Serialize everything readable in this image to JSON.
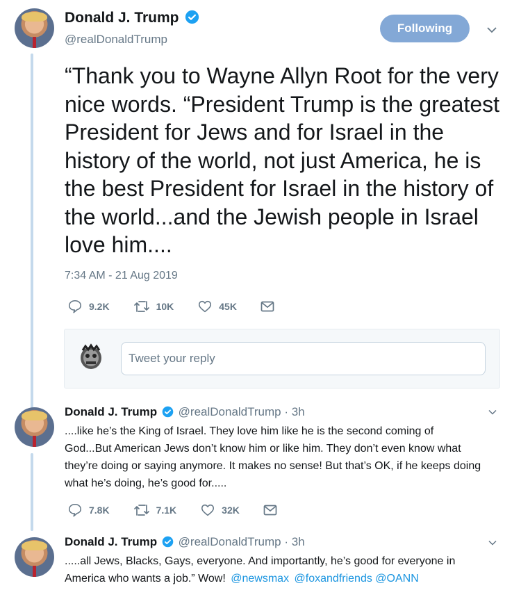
{
  "main_tweet": {
    "name": "Donald J. Trump",
    "handle": "@realDonaldTrump",
    "follow_label": "Following",
    "text": "“Thank you to Wayne Allyn Root for the very nice words. “President Trump is the greatest President for Jews and for Israel in the history of the world, not just America, he is the best President for Israel in the history of the world...and the Jewish people in Israel love him....",
    "timestamp": "7:34 AM - 21 Aug 2019",
    "replies": "9.2K",
    "retweets": "10K",
    "likes": "45K"
  },
  "reply_box": {
    "placeholder": "Tweet your reply"
  },
  "thread": [
    {
      "name": "Donald J. Trump",
      "handle": "@realDonaldTrump",
      "time": "· 3h",
      "text": "....like he’s the King of Israel. They love him like he is the second coming of God...But American Jews don’t know him or like him. They don’t even know what they’re doing or saying anymore. It makes no sense! But that’s OK, if he keeps doing what he’s doing, he’s good for.....",
      "replies": "7.8K",
      "retweets": "7.1K",
      "likes": "32K"
    },
    {
      "name": "Donald J. Trump",
      "handle": "@realDonaldTrump",
      "time": "· 3h",
      "text_before": ".....all Jews, Blacks, Gays, everyone. And importantly, he’s good for everyone in America who wants a job.” Wow!",
      "mentions": [
        "@newsmax",
        "@foxandfriends",
        "@OANN"
      ]
    }
  ],
  "colors": {
    "accent": "#1da1f2",
    "follow_button": "#83a8d6",
    "secondary_text": "#657786",
    "thread_line": "#c4d9ec"
  },
  "icons": [
    "verified-badge-icon",
    "chevron-down-icon",
    "reply-icon",
    "retweet-icon",
    "like-icon",
    "dm-icon",
    "user-avatar-icon"
  ]
}
